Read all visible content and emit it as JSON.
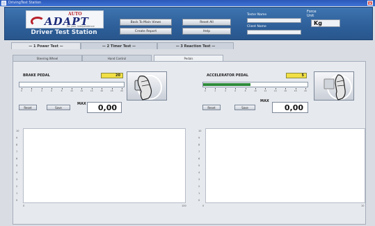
{
  "window": {
    "title": "DrivingTest Station"
  },
  "header": {
    "logo_auto": "AUTO",
    "logo_adapt": "ADAPT",
    "logo_tagline": "for your independence",
    "station_title": "Driver Test Station",
    "buttons": {
      "back": "Back To Main Views",
      "reset_all": "Reset All",
      "create_report": "Create Report",
      "help": "Help"
    },
    "tester_label": "Tester Name",
    "tester_value": "",
    "client_label": "Client Name",
    "client_value": "",
    "force_label": "Force",
    "unit_label": "Unit",
    "unit_value": "Kg"
  },
  "main_tabs": [
    {
      "label": "— 1 Power Test —",
      "active": true
    },
    {
      "label": "— 2 Timer Test —",
      "active": false
    },
    {
      "label": "— 3 Reaction Test —",
      "active": false
    }
  ],
  "sub_tabs": [
    {
      "label": "Steering Wheel",
      "active": false
    },
    {
      "label": "Hand Control",
      "active": false
    },
    {
      "label": "Pedals",
      "active": true
    }
  ],
  "brake": {
    "title": "BRAKE PEDAL",
    "value": "20",
    "level_percent": 0,
    "reset_label": "Reset",
    "save_label": "Save",
    "max_label": "MAX",
    "max_value": "0,00"
  },
  "accelerator": {
    "title": "ACCELERATOR PEDAL",
    "value": "5",
    "level_percent": 45,
    "reset_label": "Reset",
    "save_label": "Save",
    "max_label": "MAX",
    "max_value": "0,00"
  },
  "slider_ticks": [
    "0",
    "2",
    "4",
    "6",
    "8",
    "10",
    "12",
    "14",
    "16",
    "18",
    "20"
  ],
  "left_chart": {
    "y_ticks": [
      "10",
      "9",
      "8",
      "7",
      "6",
      "5",
      "4",
      "3",
      "2",
      "1",
      "0"
    ],
    "x_start": "0",
    "x_end": "100"
  },
  "right_chart": {
    "y_ticks": [
      "10",
      "9",
      "8",
      "7",
      "6",
      "5",
      "4",
      "3",
      "2",
      "1",
      "0"
    ],
    "x_start": "0",
    "x_end": "10"
  }
}
